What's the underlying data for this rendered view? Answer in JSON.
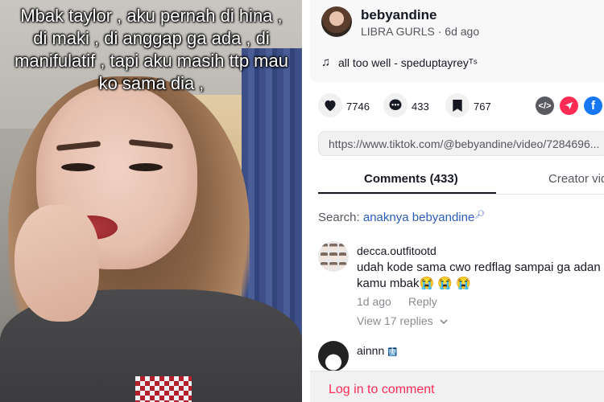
{
  "video": {
    "caption": "Mbak taylor , aku pernah di hina , di maki , di anggap ga ada , di manifulatif , tapi aku masih ttp mau ko sama dia ,"
  },
  "post": {
    "username": "bebyandine",
    "nickname": "LIBRA GURLS",
    "separator": "·",
    "posted_ago": "6d ago",
    "music": "all too well - speduptayreyᵀˢ"
  },
  "actions": {
    "likes": "7746",
    "comments": "433",
    "saves": "767"
  },
  "url": "https://www.tiktok.com/@bebyandine/video/7284696...",
  "tabs": {
    "comments": "Comments (433)",
    "creator": "Creator vid"
  },
  "search": {
    "prefix": "Search:",
    "keyword": "anaknya bebyandine"
  },
  "comments": [
    {
      "user": "decca.outfitootd",
      "text_line1": "udah kode sama cwo redflag sampai ga adan",
      "text_line2": "kamu mbak😭 😭 😭",
      "time": "1d ago",
      "reply": "Reply",
      "view_replies": "View 17 replies"
    },
    {
      "user": "ainnn",
      "badge": "🩻"
    }
  ],
  "login": "Log in to comment",
  "colors": {
    "accent": "#fe2c55",
    "link": "#2b5db9",
    "text": "#161823",
    "muted": "#8a8b91"
  }
}
